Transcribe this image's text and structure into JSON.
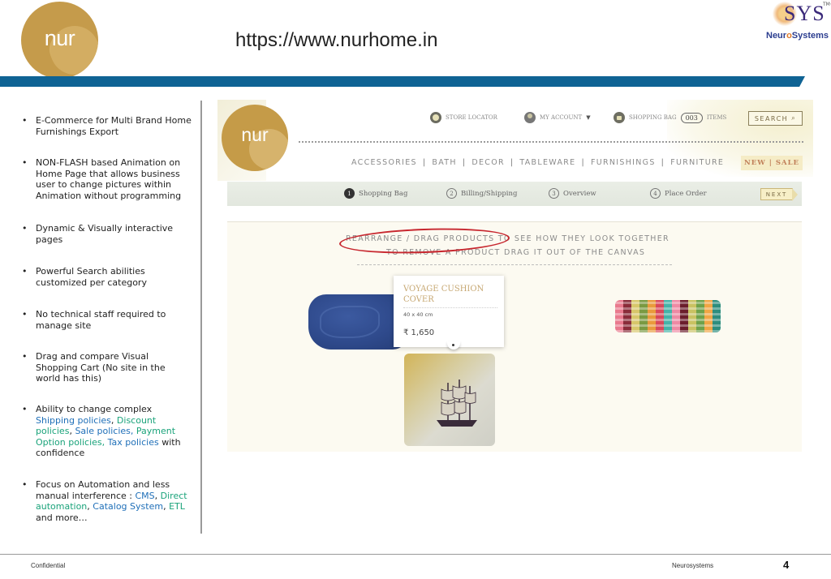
{
  "header": {
    "logo_text": "nur",
    "url": "https://www.nurhome.in",
    "company_logo": {
      "mark": "SYS",
      "tm": "TM©",
      "name_prefix": "Neur",
      "name_o": "o",
      "name_suffix": "Systems"
    },
    "accent_color": "#0f6394"
  },
  "bullets": [
    {
      "parts": [
        {
          "text": "E-Commerce for Multi Brand Home Furnishings Export",
          "color": "default"
        }
      ]
    },
    {
      "parts": [
        {
          "text": "NON-FLASH based Animation on Home Page that allows business user to change pictures within Animation without programming",
          "color": "default"
        }
      ]
    },
    {
      "parts": [
        {
          "text": "Dynamic & Visually interactive pages",
          "color": "default"
        }
      ]
    },
    {
      "parts": [
        {
          "text": "Powerful Search abilities customized per category",
          "color": "default"
        }
      ]
    },
    {
      "parts": [
        {
          "text": "No technical staff required to manage site",
          "color": "default"
        }
      ]
    },
    {
      "parts": [
        {
          "text": "Drag and compare Visual Shopping Cart (No site in the world has this)",
          "color": "default"
        }
      ]
    },
    {
      "parts": [
        {
          "text": "Ability to change complex ",
          "color": "default"
        },
        {
          "text": "Shipping policies",
          "color": "blue"
        },
        {
          "text": ", ",
          "color": "default"
        },
        {
          "text": "Discount policies",
          "color": "green"
        },
        {
          "text": ", ",
          "color": "default"
        },
        {
          "text": "Sale policies, ",
          "color": "blue"
        },
        {
          "text": "Payment Option policies, ",
          "color": "green"
        },
        {
          "text": "Tax policies",
          "color": "blue"
        },
        {
          "text": " with confidence",
          "color": "default"
        }
      ]
    },
    {
      "parts": [
        {
          "text": "Focus on Automation and less manual interference : ",
          "color": "default"
        },
        {
          "text": "CMS",
          "color": "blue"
        },
        {
          "text": ", ",
          "color": "default"
        },
        {
          "text": "Direct automation",
          "color": "green"
        },
        {
          "text": ", ",
          "color": "default"
        },
        {
          "text": "Catalog System",
          "color": "blue"
        },
        {
          "text": ", ",
          "color": "default"
        },
        {
          "text": "ETL",
          "color": "green"
        },
        {
          "text": " and more…",
          "color": "default"
        }
      ]
    }
  ],
  "site": {
    "logo_text": "nur",
    "utility": {
      "store_locator": "STORE LOCATOR",
      "my_account": "MY ACCOUNT",
      "shopping_bag": "SHOPPING BAG",
      "bag_count": "003",
      "items": "ITEMS",
      "search": "SEARCH"
    },
    "nav": [
      "ACCESSORIES",
      "BATH",
      "DECOR",
      "TABLEWARE",
      "FURNISHINGS",
      "FURNITURE"
    ],
    "nav_sep": "|",
    "new_label": "NEW",
    "sale_label": "SALE",
    "steps": [
      {
        "num": "1",
        "label": "Shopping Bag",
        "active": true
      },
      {
        "num": "2",
        "label": "Billing/Shipping",
        "active": false
      },
      {
        "num": "3",
        "label": "Overview",
        "active": false
      },
      {
        "num": "4",
        "label": "Place Order",
        "active": false
      }
    ],
    "next": "NEXT",
    "instruction_1": "REARRANGE / DRAG PRODUCTS TO SEE HOW THEY LOOK TOGETHER",
    "instruction_2": "TO REMOVE A PRODUCT DRAG IT OUT OF THE CANVAS",
    "tooltip": {
      "name": "VOYAGE CUSHION COVER",
      "size": "40 x 40 cm",
      "price": "₹ 1,650"
    }
  },
  "footer": {
    "confidential": "Confidential",
    "company": "Neurosystems",
    "page": "4"
  }
}
